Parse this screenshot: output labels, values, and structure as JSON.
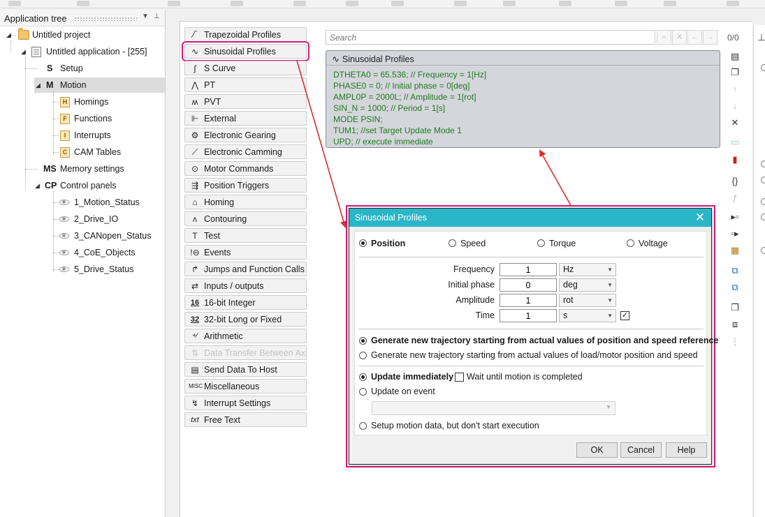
{
  "tree": {
    "title": "Application tree",
    "nodes": {
      "project": "Untitled project",
      "application": "Untitled application - [255]",
      "setup": "Setup",
      "motion": "Motion",
      "homings": "Homings",
      "functions": "Functions",
      "interrupts": "Interrupts",
      "cam_tables": "CAM Tables",
      "memory": "Memory settings",
      "control_panels": "Control panels",
      "panel_1": "1_Motion_Status",
      "panel_2": "2_Drive_IO",
      "panel_3": "3_CANopen_Status",
      "panel_4": "4_CoE_Objects",
      "panel_5": "5_Drive_Status"
    },
    "icons": {
      "setup": "S",
      "motion": "M",
      "memory": "MS",
      "control_panels": "CP"
    }
  },
  "palette": [
    {
      "label": "Trapezoidal Profiles",
      "icon": "⁄‾"
    },
    {
      "label": "Sinusoidal Profiles",
      "icon": "∿"
    },
    {
      "label": "S Curve",
      "icon": "ʃ"
    },
    {
      "label": "PT",
      "icon": "⋀"
    },
    {
      "label": "PVT",
      "icon": "ʍ"
    },
    {
      "label": "External",
      "icon": "⊩"
    },
    {
      "label": "Electronic Gearing",
      "icon": "⚙"
    },
    {
      "label": "Electronic Camming",
      "icon": "⟋"
    },
    {
      "label": "Motor Commands",
      "icon": "⊙"
    },
    {
      "label": "Position Triggers",
      "icon": "⇶"
    },
    {
      "label": "Homing",
      "icon": "⌂"
    },
    {
      "label": "Contouring",
      "icon": "ʌ"
    },
    {
      "label": "Test",
      "icon": "T"
    },
    {
      "label": "Events",
      "icon": "!⊖"
    },
    {
      "label": "Jumps and Function Calls",
      "icon": "↱"
    },
    {
      "label": "Inputs / outputs",
      "icon": "⇄"
    },
    {
      "label": "16-bit Integer",
      "icon": "16"
    },
    {
      "label": "32-bit Long or Fixed",
      "icon": "32"
    },
    {
      "label": "Arithmetic",
      "icon": "+⁄"
    },
    {
      "label": "Data Transfer Between Axes",
      "icon": "⇅"
    },
    {
      "label": "Send Data To Host",
      "icon": "▤"
    },
    {
      "label": "Miscellaneous",
      "icon": "MISC"
    },
    {
      "label": "Interrupt Settings",
      "icon": "↯"
    },
    {
      "label": "Free Text",
      "icon": "txt"
    }
  ],
  "search": {
    "placeholder": "Search",
    "counter": "0/0"
  },
  "code_block": {
    "title": "Sinusoidal Profiles",
    "lines": [
      "DTHETA0 = 65.536; // Frequency = 1[Hz]",
      "PHASE0 = 0; // Initial phase = 0[deg]",
      "AMPL0P = 2000L; // Amplitude = 1[rot]",
      "SIN_N = 1000; // Period = 1[s]",
      "MODE PSIN;",
      "TUM1; //set Target Update Mode 1",
      "UPD; // execute immediate"
    ]
  },
  "dialog": {
    "title": "Sinusoidal Profiles",
    "modes": [
      "Position",
      "Speed",
      "Torque",
      "Voltage"
    ],
    "fields": [
      {
        "label": "Frequency",
        "value": "1",
        "unit": "Hz"
      },
      {
        "label": "Initial phase",
        "value": "0",
        "unit": "deg"
      },
      {
        "label": "Amplitude",
        "value": "1",
        "unit": "rot"
      },
      {
        "label": "Time",
        "value": "1",
        "unit": "s"
      }
    ],
    "trajectory_options": [
      "Generate new trajectory starting from actual values of position and speed reference",
      "Generate new trajectory starting from actual values of load/motor position and speed"
    ],
    "update_immediately": "Update immediately",
    "wait_until": "Wait until motion is completed",
    "update_on_event": "Update on event",
    "setup_only": "Setup motion data, but don't start execution",
    "buttons": {
      "ok": "OK",
      "cancel": "Cancel",
      "help": "Help"
    }
  },
  "colors": {
    "accent": "#d6197f",
    "dialog_title": "#29b6c8",
    "code_text": "#1f7a1f"
  }
}
